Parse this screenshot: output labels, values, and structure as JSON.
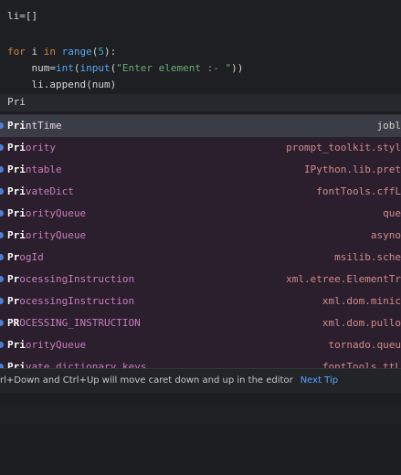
{
  "editor": {
    "line1": "li=[]",
    "line2": {
      "kw_for": "for",
      "var": " i ",
      "kw_in": "in",
      "fn_range": " range",
      "paren_open": "(",
      "num": "5",
      "paren_close": "):"
    },
    "line3": {
      "indent": "    ",
      "lhs": "num=",
      "fn_int": "int",
      "p1": "(",
      "fn_input": "input",
      "p2": "(",
      "str": "\"Enter element :- \"",
      "p3": "))"
    },
    "line4": "    li.append(num)",
    "line5": "Pri"
  },
  "completion": {
    "items": [
      {
        "name_match": "Pri",
        "name_rest": "ntTime",
        "source": "jobl"
      },
      {
        "name_match": "Pri",
        "name_rest": "ority",
        "source": "prompt_toolkit.styl"
      },
      {
        "name_match": "Pri",
        "name_rest": "ntable",
        "source": "IPython.lib.pret"
      },
      {
        "name_match": "Pri",
        "name_rest": "vateDict",
        "source": "fontTools.cffL"
      },
      {
        "name_match": "Pri",
        "name_rest": "orityQueue",
        "source": "que"
      },
      {
        "name_match": "Pri",
        "name_rest": "orityQueue",
        "source": "asyno"
      },
      {
        "name_match": "Pr",
        "name_rest": "ogId",
        "source": "msilib.sche"
      },
      {
        "name_match": "Pr",
        "name_rest": "ocessingInstruction",
        "source": "xml.etree.ElementTr"
      },
      {
        "name_match": "Pr",
        "name_rest": "ocessingInstruction",
        "source": "xml.dom.minic"
      },
      {
        "name_match": "PR",
        "name_rest": "OCESSING_INSTRUCTION",
        "source": "xml.dom.pullo"
      },
      {
        "name_match": "Pri",
        "name_rest": "orityQueue",
        "source": "tornado.queu"
      },
      {
        "name_match": "Pri",
        "name_rest": "vate_dictionary_keys",
        "source": "fontTools.ttL"
      }
    ]
  },
  "tip": {
    "text": "rl+Down and Ctrl+Up will move caret down and up in the editor",
    "link": "Next Tip"
  }
}
